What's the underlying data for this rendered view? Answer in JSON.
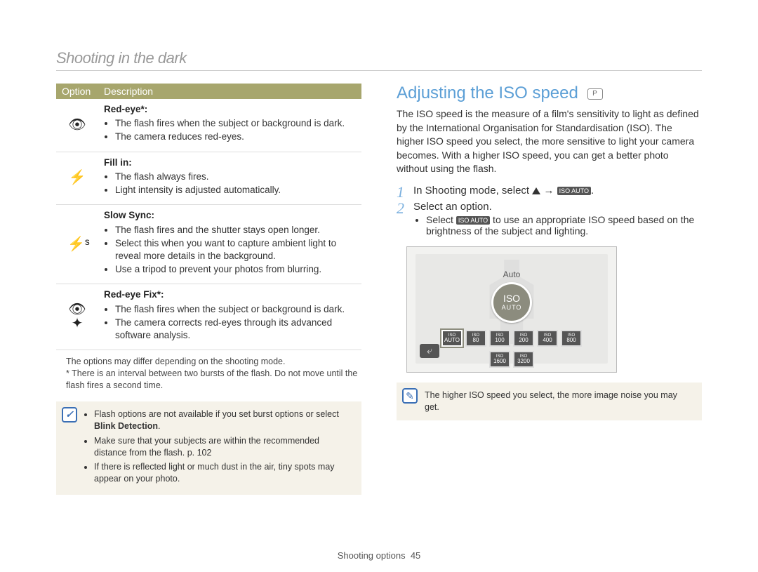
{
  "breadcrumb": "Shooting in the dark",
  "table": {
    "header": {
      "col1": "Option",
      "col2": "Description"
    },
    "rows": [
      {
        "icon_glyph": "👁",
        "title": "Red-eye*:",
        "bullets": [
          "The flash fires when the subject or background is dark.",
          "The camera reduces red-eyes."
        ]
      },
      {
        "icon_glyph": "⚡",
        "title": "Fill in:",
        "bullets": [
          "The flash always fires.",
          "Light intensity is adjusted automatically."
        ]
      },
      {
        "icon_glyph": "⚡ˢ",
        "title": "Slow Sync:",
        "bullets": [
          "The flash fires and the shutter stays open longer.",
          "Select this when you want to capture ambient light to reveal more details in the background.",
          "Use a tripod to prevent your photos from blurring."
        ]
      },
      {
        "icon_glyph": "👁✦",
        "title": "Red-eye Fix*:",
        "bullets": [
          "The flash fires when the subject or background is dark.",
          "The camera corrects red-eyes through its advanced software analysis."
        ]
      }
    ]
  },
  "below_notes": {
    "line1": "The options may differ depending on the shooting mode.",
    "line2": "* There is an interval between two bursts of the flash. Do not move until the flash fires a second time."
  },
  "infobox_left": {
    "items": [
      "Flash options are not available if you set burst options or select Blink Detection.",
      "Make sure that your subjects are within the recommended distance from the flash. p. 102",
      "If there is reflected light or much dust in the air, tiny spots may appear on your photo."
    ],
    "bold_in_0": "Blink Detection"
  },
  "right": {
    "title": "Adjusting the ISO speed",
    "mode_icon_label": "P",
    "intro": "The ISO speed is the measure of a film's sensitivity to light as defined by the International Organisation for Standardisation (ISO). The higher ISO speed you select, the more sensitive to light your camera becomes. With a higher ISO speed, you can get a better photo without using the flash.",
    "step1_pre": "In Shooting mode, select ",
    "step1_arrow": " → ",
    "step1_chip": "ISO AUTO",
    "step1_post": ".",
    "step2": "Select an option.",
    "step2_sub_pre": "Select ",
    "step2_sub_chip": "ISO AUTO",
    "step2_sub_post": " to use an appropriate ISO speed based on the brightness of the subject and lighting.",
    "lcd": {
      "auto_label": "Auto",
      "badge_line1": "ISO",
      "badge_line2": "AUTO",
      "row1": [
        "AUTO",
        "80",
        "100",
        "200",
        "400",
        "800"
      ],
      "row2": [
        "1600",
        "3200"
      ]
    },
    "info_note": "The higher ISO speed you select, the more image noise you may get."
  },
  "footer": {
    "section": "Shooting options",
    "page": "45"
  }
}
